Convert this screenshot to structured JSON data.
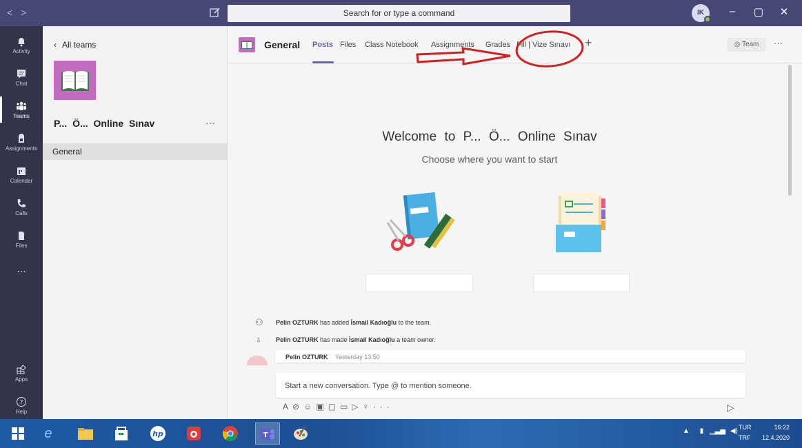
{
  "titlebar": {
    "search_placeholder": "Search for or type a command",
    "avatar_initials": "IK",
    "nav_back": "<",
    "nav_forward": ">"
  },
  "appbar": {
    "items": [
      {
        "label": "Activity",
        "icon": "bell-icon"
      },
      {
        "label": "Chat",
        "icon": "chat-icon"
      },
      {
        "label": "Teams",
        "icon": "teams-icon"
      },
      {
        "label": "Assignments",
        "icon": "assignments-icon"
      },
      {
        "label": "Calendar",
        "icon": "calendar-icon"
      },
      {
        "label": "Calls",
        "icon": "phone-icon"
      },
      {
        "label": "Files",
        "icon": "file-icon"
      }
    ],
    "more": "...",
    "apps_label": "Apps",
    "help_label": "Help"
  },
  "teampanel": {
    "back_label": "All teams",
    "team_name": "P... Ö... Online Sınav",
    "more": "···",
    "channel": "General"
  },
  "main": {
    "channel_title": "General",
    "tabs": [
      "Posts",
      "Files",
      "Class Notebook",
      "Assignments",
      "Grades",
      "Fill | Vize Sınavı"
    ],
    "team_button": "Team",
    "more": "···",
    "welcome_title": "Welcome to P... Ö... Online Sınav",
    "welcome_subtitle": "Choose where you want to start",
    "activity": [
      {
        "actor": "Pelin OZTURK",
        "text_a": "has added",
        "target": "İsmail Kadıoğlu",
        "text_b": "to the team."
      },
      {
        "actor": "Pelin OZTURK",
        "text_a": "has made",
        "target": "İsmail Kadıoğlu",
        "text_b": "a team owner."
      }
    ],
    "post_author": "Pelin OZTURK",
    "post_time": "Yesterday 13:50",
    "compose_placeholder": "Start a new conversation. Type @ to mention someone."
  },
  "taskbar": {
    "lang_top": "TUR",
    "lang_bottom": "TRF",
    "time": "16:22",
    "date": "12.4.2020"
  },
  "colors": {
    "titlebar": "#464775",
    "appbar": "#33344a",
    "accent": "#6264a7",
    "team_logo": "#c36bc0",
    "annotation": "#d02020"
  }
}
